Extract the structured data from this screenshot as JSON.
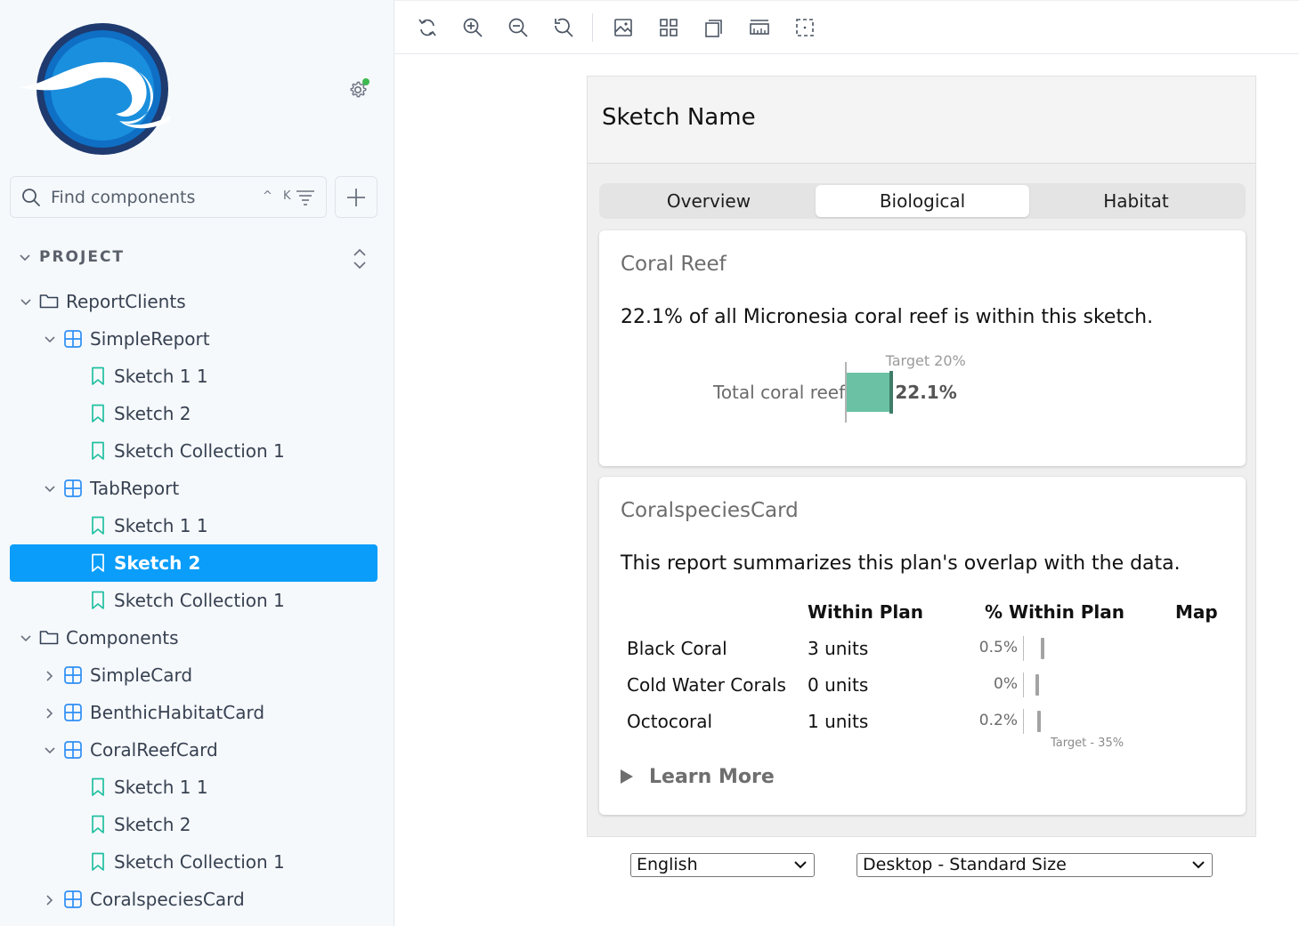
{
  "colors": {
    "accent": "#0a9dfa",
    "tree_icon": "#2f8ff5",
    "bookmark_icon": "#20c0a0",
    "folder_icon": "#334155",
    "bar_fill": "#6ac1a3",
    "bar_target": "#3e7d69",
    "status_dot": "#3fb950"
  },
  "sidebar": {
    "search": {
      "placeholder": "Find components",
      "shortcut": "^ K"
    },
    "project_title": "PROJECT",
    "tree": [
      {
        "label": "ReportClients",
        "type": "folder",
        "expanded": true
      },
      {
        "label": "SimpleReport",
        "type": "component",
        "expanded": true
      },
      {
        "label": "Sketch 1 1",
        "type": "story"
      },
      {
        "label": "Sketch 2",
        "type": "story"
      },
      {
        "label": "Sketch Collection 1",
        "type": "story"
      },
      {
        "label": "TabReport",
        "type": "component",
        "expanded": true
      },
      {
        "label": "Sketch 1 1",
        "type": "story"
      },
      {
        "label": "Sketch 2",
        "type": "story",
        "selected": true
      },
      {
        "label": "Sketch Collection 1",
        "type": "story"
      },
      {
        "label": "Components",
        "type": "folder",
        "expanded": true
      },
      {
        "label": "SimpleCard",
        "type": "component",
        "expanded": false
      },
      {
        "label": "BenthicHabitatCard",
        "type": "component",
        "expanded": false
      },
      {
        "label": "CoralReefCard",
        "type": "component",
        "expanded": true
      },
      {
        "label": "Sketch 1 1",
        "type": "story"
      },
      {
        "label": "Sketch 2",
        "type": "story"
      },
      {
        "label": "Sketch Collection 1",
        "type": "story"
      },
      {
        "label": "CoralspeciesCard",
        "type": "component",
        "expanded": false
      }
    ]
  },
  "toolbar": {
    "buttons": [
      "reload-icon",
      "zoom-in-icon",
      "zoom-out-icon",
      "reset-zoom-icon",
      "image-icon",
      "grid-icon",
      "tabs-icon",
      "ruler-icon",
      "outline-icon"
    ]
  },
  "report": {
    "title": "Sketch Name",
    "tabs": [
      "Overview",
      "Biological",
      "Habitat"
    ],
    "active_tab": "Biological",
    "coral_reef": {
      "title": "Coral Reef",
      "summary": "22.1% of all Micronesia coral reef is within this sketch.",
      "bar_label": "Total coral reef",
      "value_text": "22.1%",
      "value": 22.1,
      "target_text": "Target 20%",
      "target": 20
    },
    "species": {
      "title": "CoralspeciesCard",
      "summary": "This report summarizes this plan's overlap with the data.",
      "headers": [
        "",
        "Within Plan",
        "% Within Plan",
        "Map"
      ],
      "rows": [
        {
          "name": "Black Coral",
          "within": "3 units",
          "pct": "0.5%",
          "pct_value": 0.5
        },
        {
          "name": "Cold Water Corals",
          "within": "0 units",
          "pct": "0%",
          "pct_value": 0
        },
        {
          "name": "Octocoral",
          "within": "1 units",
          "pct": "0.2%",
          "pct_value": 0.2
        }
      ],
      "target_text": "Target - 35%",
      "learn_more": "Learn More"
    }
  },
  "footer": {
    "language": "English",
    "viewport": "Desktop - Standard Size"
  }
}
